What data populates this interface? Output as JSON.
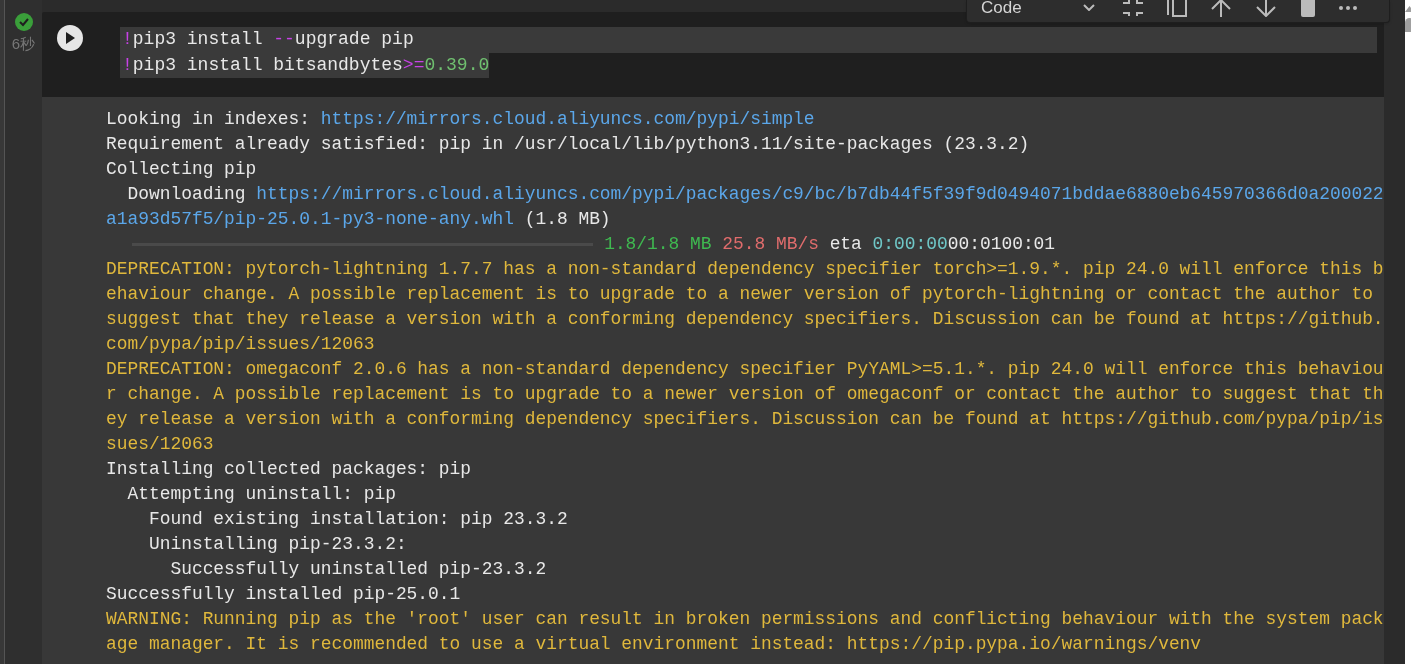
{
  "toolbar": {
    "cell_type": "Code"
  },
  "cell": {
    "succeeded": true,
    "duration": "6秒",
    "code_lines": [
      {
        "highlighted": true,
        "segments": [
          {
            "kind": "op",
            "text": "!"
          },
          {
            "kind": "plain",
            "text": "pip3 install "
          },
          {
            "kind": "op",
            "text": "--"
          },
          {
            "kind": "plain",
            "text": "upgrade pip"
          }
        ]
      },
      {
        "highlighted": true,
        "segments": [
          {
            "kind": "op",
            "text": "!"
          },
          {
            "kind": "plain",
            "text": "pip3 install bitsandbytes"
          },
          {
            "kind": "op",
            "text": ">="
          },
          {
            "kind": "number",
            "text": "0.39.0"
          }
        ]
      }
    ]
  },
  "output": [
    [
      {
        "kind": "plain",
        "text": "Looking in indexes: "
      },
      {
        "kind": "link",
        "text": "https://mirrors.cloud.aliyuncs.com/pypi/simple"
      }
    ],
    [
      {
        "kind": "plain",
        "text": "Requirement already satisfied: pip in /usr/local/lib/python3.11/site-packages (23.3.2)"
      }
    ],
    [
      {
        "kind": "plain",
        "text": "Collecting pip"
      }
    ],
    [
      {
        "kind": "plain",
        "text": "  Downloading "
      },
      {
        "kind": "link",
        "text": "https://mirrors.cloud.aliyuncs.com/pypi/packages/c9/bc/b7db44f5f39f9d0494071bddae6880eb645970366d0a200022"
      }
    ],
    [
      {
        "kind": "link",
        "text": "a1a93d57f5/pip-25.0.1-py3-none-any.whl"
      },
      {
        "kind": "plain",
        "text": " (1.8 MB)"
      }
    ],
    [
      {
        "kind": "bar",
        "level": 1
      },
      {
        "kind": "green",
        "text": " 1.8/1.8 MB"
      },
      {
        "kind": "red",
        "text": " 25.8 MB/s"
      },
      {
        "kind": "plain",
        "text": " eta "
      },
      {
        "kind": "cyan",
        "text": "0:00:00"
      },
      {
        "kind": "plain",
        "text": "00:0100:01"
      }
    ],
    [
      {
        "kind": "warn",
        "text": "DEPRECATION: pytorch-lightning 1.7.7 has a non-standard dependency specifier torch>=1.9.*. pip 24.0 will enforce this b"
      }
    ],
    [
      {
        "kind": "warn",
        "text": "ehaviour change. A possible replacement is to upgrade to a newer version of pytorch-lightning or contact the author to"
      }
    ],
    [
      {
        "kind": "warn",
        "text": "suggest that they release a version with a conforming dependency specifiers. Discussion can be found at https://github."
      }
    ],
    [
      {
        "kind": "warn",
        "text": "com/pypa/pip/issues/12063"
      }
    ],
    [
      {
        "kind": "warn",
        "text": "DEPRECATION: omegaconf 2.0.6 has a non-standard dependency specifier PyYAML>=5.1.*. pip 24.0 will enforce this behaviou"
      }
    ],
    [
      {
        "kind": "warn",
        "text": "r change. A possible replacement is to upgrade to a newer version of omegaconf or contact the author to suggest that th"
      }
    ],
    [
      {
        "kind": "warn",
        "text": "ey release a version with a conforming dependency specifiers. Discussion can be found at https://github.com/pypa/pip/is"
      }
    ],
    [
      {
        "kind": "warn",
        "text": "sues/12063"
      }
    ],
    [
      {
        "kind": "plain",
        "text": "Installing collected packages: pip"
      }
    ],
    [
      {
        "kind": "plain",
        "text": "  Attempting uninstall: pip"
      }
    ],
    [
      {
        "kind": "plain",
        "text": "    Found existing installation: pip 23.3.2"
      }
    ],
    [
      {
        "kind": "plain",
        "text": "    Uninstalling pip-23.3.2:"
      }
    ],
    [
      {
        "kind": "plain",
        "text": "      Successfully uninstalled pip-23.3.2"
      }
    ],
    [
      {
        "kind": "plain",
        "text": "Successfully installed pip-25.0.1"
      }
    ],
    [
      {
        "kind": "warn",
        "text": "WARNING: Running pip as the 'root' user can result in broken permissions and conflicting behaviour with the system pack"
      }
    ],
    [
      {
        "kind": "warn",
        "text": "age manager. It is recommended to use a virtual environment instead: https://pip.pypa.io/warnings/venv"
      }
    ]
  ]
}
